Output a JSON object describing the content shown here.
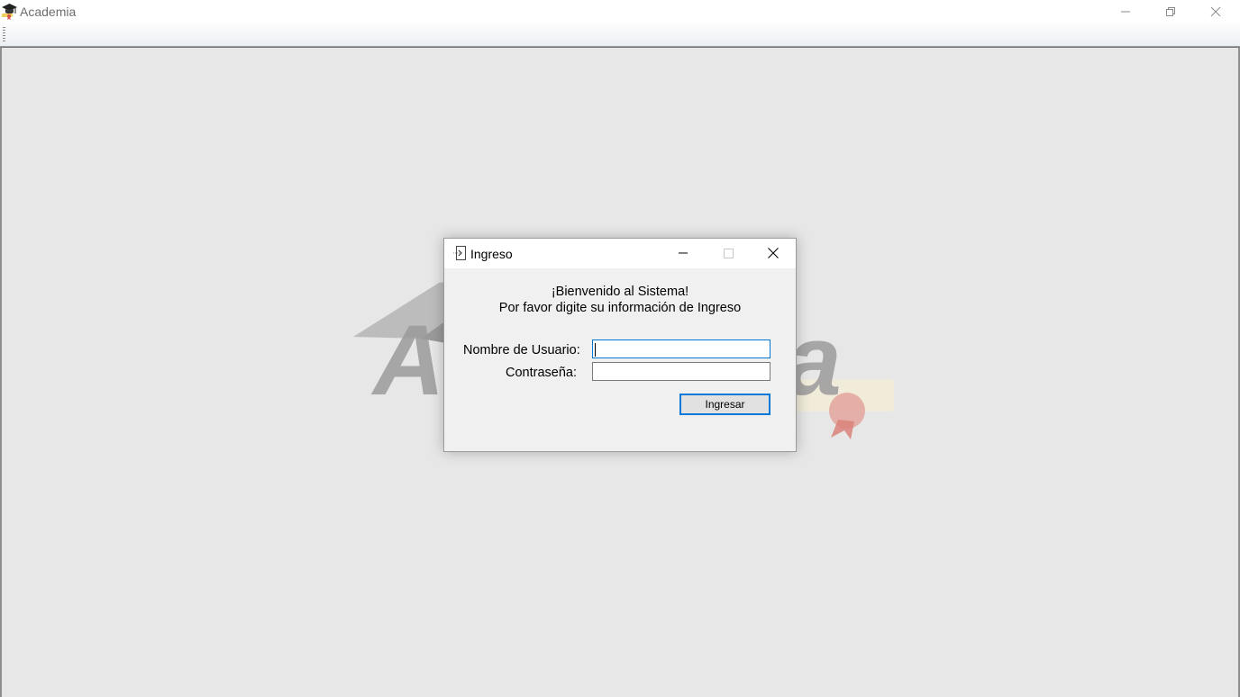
{
  "window": {
    "title": "Academia",
    "icon": "graduation-cap-icon",
    "controls": [
      "minimize-icon",
      "restore-icon",
      "close-icon"
    ]
  },
  "background_logo": {
    "text": "Academia"
  },
  "dialog": {
    "title": "Ingreso",
    "icon": "login-door-icon",
    "controls": [
      "minimize-icon",
      "maximize-icon",
      "close-icon"
    ],
    "welcome_line1": "¡Bienvenido al Sistema!",
    "welcome_line2": "Por favor digite su información de Ingreso",
    "username_label": "Nombre de Usuario:",
    "username_value": "",
    "password_label": "Contraseña:",
    "password_value": "",
    "submit_label": "Ingresar"
  },
  "colors": {
    "focus_accent": "#0078d7",
    "mdi_background": "#e7e7e7",
    "dialog_background": "#f0f0f0"
  }
}
